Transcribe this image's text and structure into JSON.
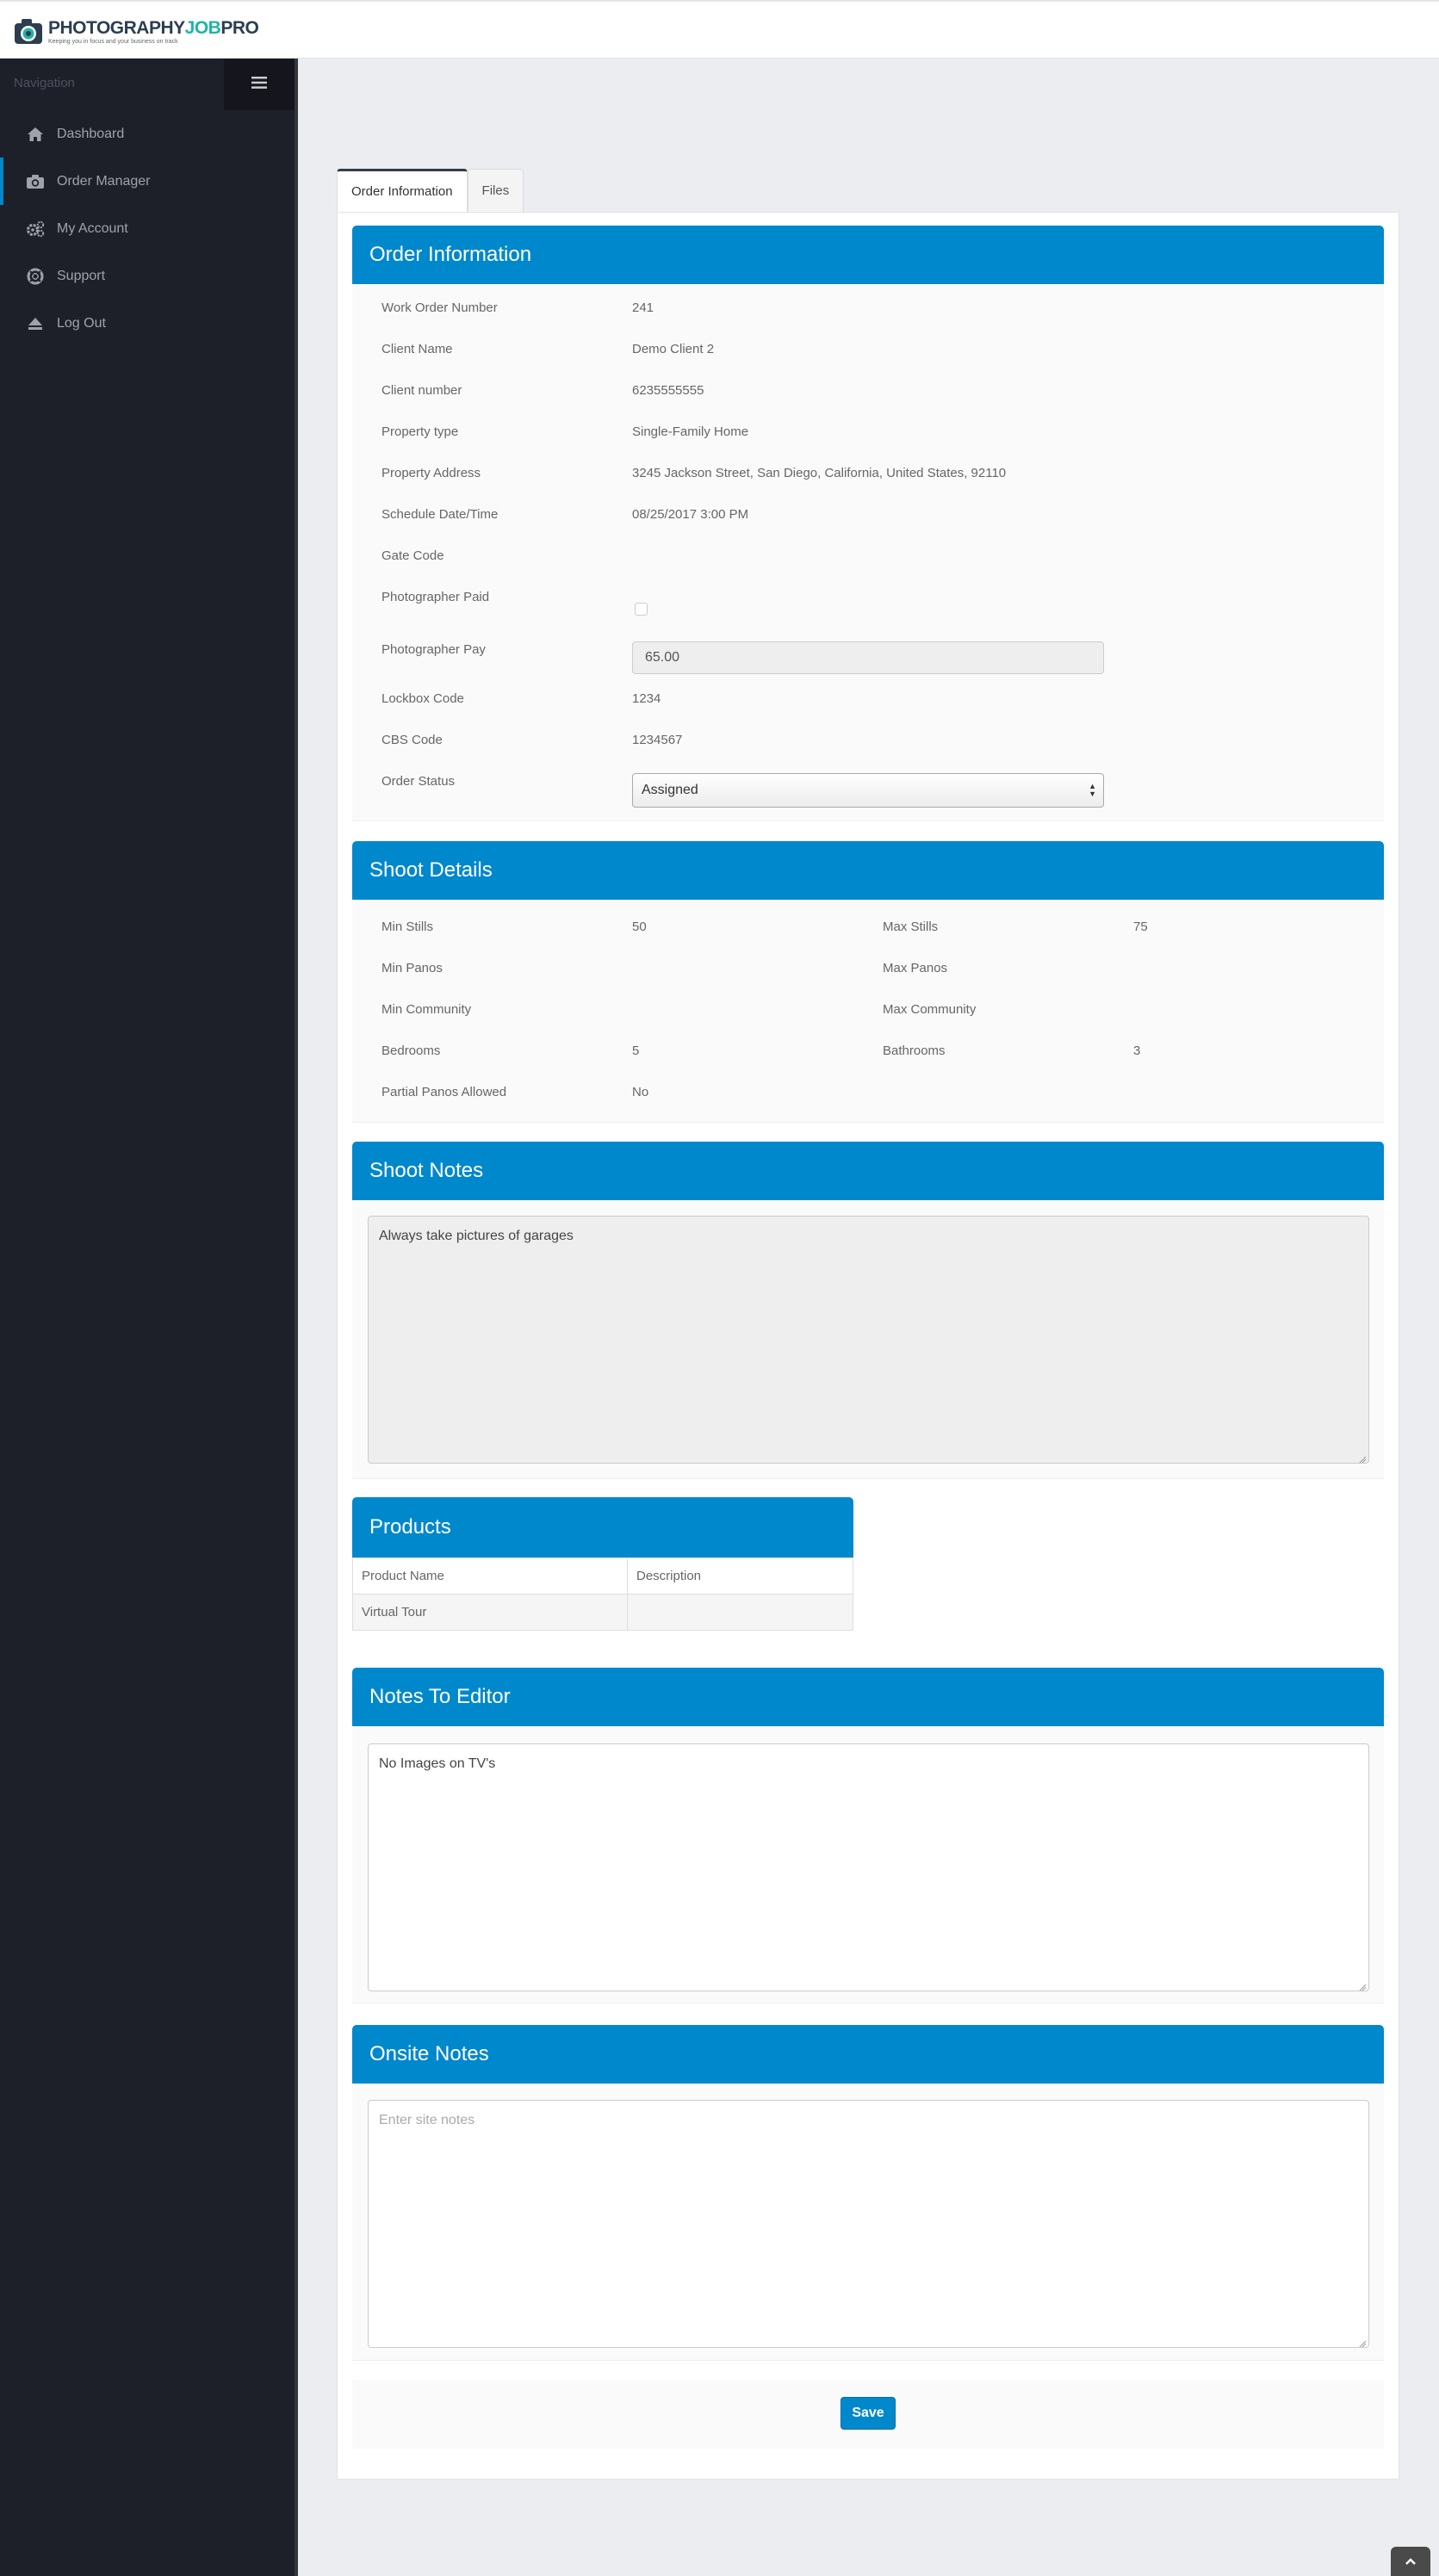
{
  "header": {
    "logo_prefix": "PHOTOGRAPHY",
    "logo_accent": "JOB",
    "logo_suffix": "PRO",
    "logo_tagline": "Keeping you in focus and your business on track"
  },
  "sidebar": {
    "title": "Navigation",
    "items": [
      {
        "label": "Dashboard",
        "icon": "home-icon"
      },
      {
        "label": "Order Manager",
        "icon": "camera-icon"
      },
      {
        "label": "My Account",
        "icon": "gears-icon"
      },
      {
        "label": "Support",
        "icon": "life-ring-icon"
      },
      {
        "label": "Log Out",
        "icon": "eject-icon"
      }
    ],
    "active_index": 1
  },
  "tabs": [
    {
      "label": "Order Information",
      "active": true
    },
    {
      "label": "Files",
      "active": false
    }
  ],
  "order_info": {
    "title": "Order Information",
    "fields": {
      "work_order_number": {
        "label": "Work Order Number",
        "value": "241"
      },
      "client_name": {
        "label": "Client Name",
        "value": "Demo Client 2"
      },
      "client_number": {
        "label": "Client number",
        "value": "6235555555"
      },
      "property_type": {
        "label": "Property type",
        "value": "Single-Family Home"
      },
      "property_address": {
        "label": "Property Address",
        "value": "3245 Jackson Street, San Diego, California, United States, 92110"
      },
      "schedule": {
        "label": "Schedule Date/Time",
        "value": "08/25/2017 3:00 PM"
      },
      "gate_code": {
        "label": "Gate Code",
        "value": ""
      },
      "photographer_paid": {
        "label": "Photographer Paid",
        "checked": false
      },
      "photographer_pay": {
        "label": "Photographer Pay",
        "value": "65.00"
      },
      "lockbox_code": {
        "label": "Lockbox Code",
        "value": "1234"
      },
      "cbs_code": {
        "label": "CBS Code",
        "value": "1234567"
      },
      "order_status": {
        "label": "Order Status",
        "value": "Assigned"
      }
    }
  },
  "shoot_details": {
    "title": "Shoot Details",
    "min_stills": {
      "label": "Min Stills",
      "value": "50"
    },
    "max_stills": {
      "label": "Max Stills",
      "value": "75"
    },
    "min_panos": {
      "label": "Min Panos",
      "value": ""
    },
    "max_panos": {
      "label": "Max Panos",
      "value": ""
    },
    "min_community": {
      "label": "Min Community",
      "value": ""
    },
    "max_community": {
      "label": "Max Community",
      "value": ""
    },
    "bedrooms": {
      "label": "Bedrooms",
      "value": "5"
    },
    "bathrooms": {
      "label": "Bathrooms",
      "value": "3"
    },
    "partial_panos": {
      "label": "Partial Panos Allowed",
      "value": "No"
    }
  },
  "shoot_notes": {
    "title": "Shoot Notes",
    "text": "Always take pictures of garages"
  },
  "products": {
    "title": "Products",
    "columns": [
      "Product Name",
      "Description"
    ],
    "rows": [
      [
        "Virtual Tour",
        ""
      ]
    ]
  },
  "notes_to_editor": {
    "title": "Notes To Editor",
    "text": "No Images on TV's"
  },
  "onsite_notes": {
    "title": "Onsite Notes",
    "placeholder": "Enter site notes"
  },
  "save_label": "Save",
  "colors": {
    "primary": "#0088cc",
    "sidebar_bg": "#1e2029",
    "page_bg": "#ebedf0"
  }
}
